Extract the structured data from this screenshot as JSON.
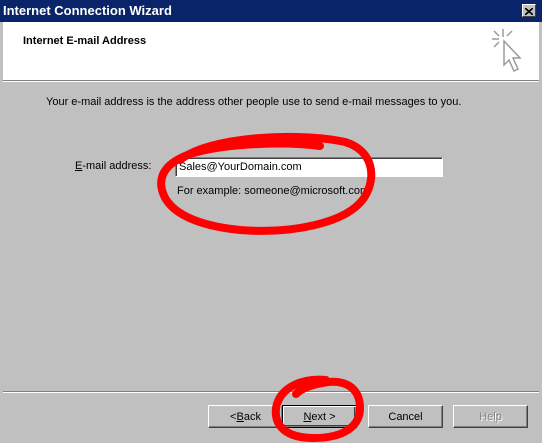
{
  "window": {
    "title": "Internet Connection Wizard"
  },
  "header": {
    "title": "Internet E-mail Address"
  },
  "body": {
    "description": "Your e-mail address is the address other people use to send e-mail messages to you.",
    "email_label_accel": "E",
    "email_label_rest": "-mail address:",
    "email_value": "Sales@YourDomain.com",
    "example_text": "For example: someone@microsoft.com"
  },
  "buttons": {
    "back_prefix": "< ",
    "back_accel": "B",
    "back_rest": "ack",
    "next_accel": "N",
    "next_rest": "ext >",
    "cancel": "Cancel",
    "help": "Help"
  },
  "colors": {
    "titlebar": "#0a246a",
    "annotation": "#ff0000",
    "face": "#c0c0c0"
  }
}
